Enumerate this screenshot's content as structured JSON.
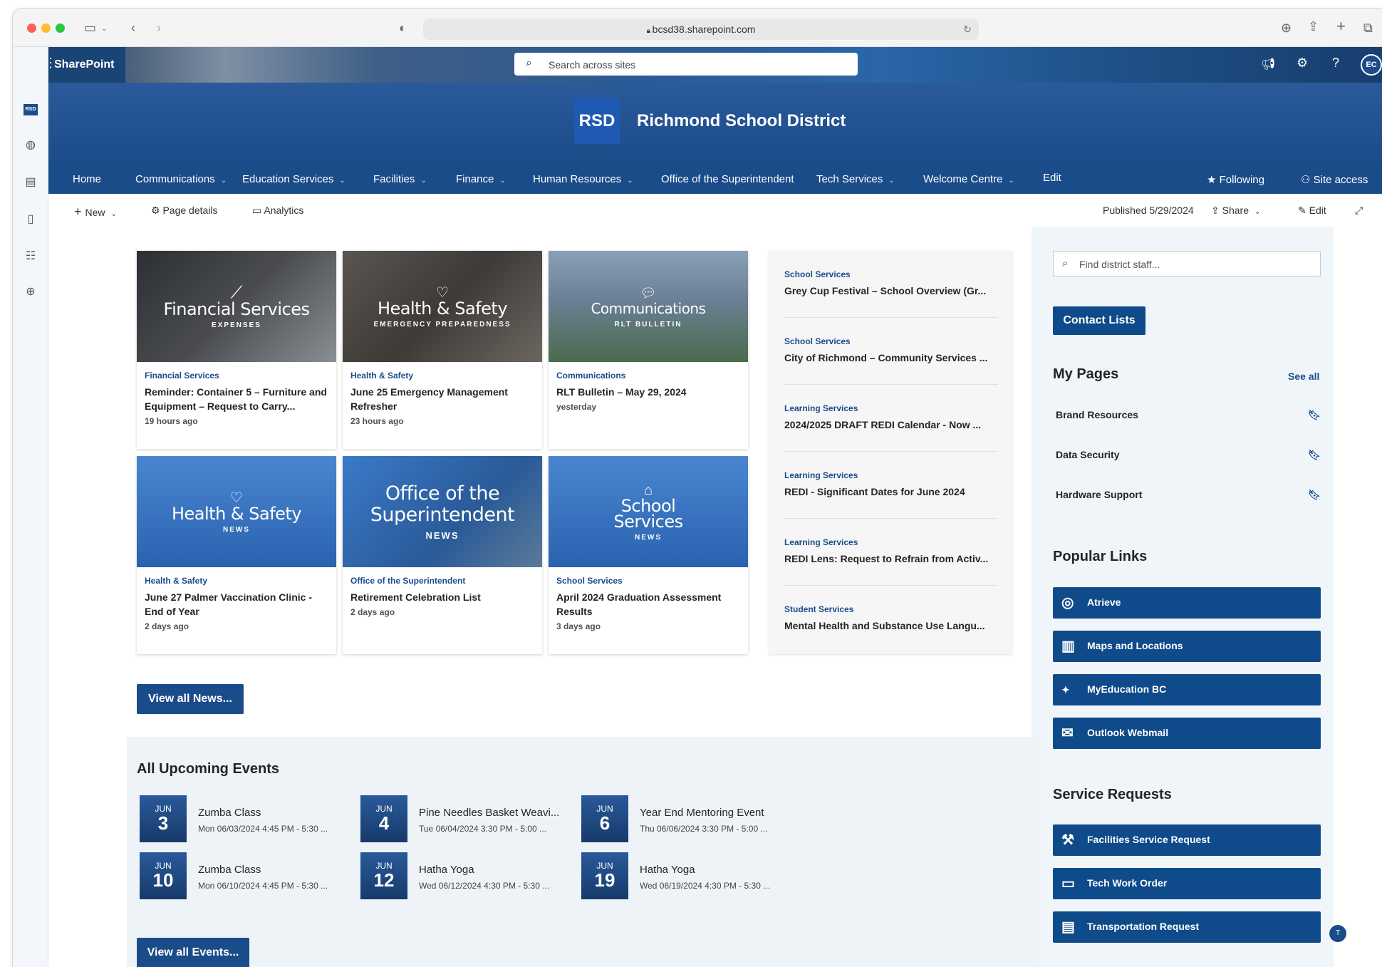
{
  "browser": {
    "url": "bcsd38.sharepoint.com"
  },
  "suite": {
    "app_name": "SharePoint",
    "search_placeholder": "Search across sites",
    "avatar": "EC"
  },
  "site": {
    "logo": "RSD",
    "title": "Richmond School District"
  },
  "nav": {
    "items": [
      "Home",
      "Communications",
      "Education Services",
      "Facilities",
      "Finance",
      "Human Resources",
      "Office of the Superintendent",
      "Tech Services",
      "Welcome Centre",
      "Edit"
    ],
    "following": "Following",
    "site_access": "Site access"
  },
  "commandbar": {
    "new": "New",
    "page_details": "Page details",
    "analytics": "Analytics",
    "published": "Published 5/29/2024",
    "share": "Share",
    "edit": "Edit"
  },
  "news_cards": [
    {
      "img_title": "Financial Services",
      "img_sub": "EXPENSES",
      "category": "Financial Services",
      "title": "Reminder: Container 5 – Furniture and Equipment – Request to Carry...",
      "time": "19 hours ago"
    },
    {
      "img_title": "Health & Safety",
      "img_sub": "EMERGENCY PREPAREDNESS",
      "category": "Health & Safety",
      "title": "June 25 Emergency Management Refresher",
      "time": "23 hours ago"
    },
    {
      "img_title": "Communications",
      "img_sub": "RLT BULLETIN",
      "category": "Communications",
      "title": "RLT Bulletin – May 29, 2024",
      "time": "yesterday"
    },
    {
      "img_title": "Health & Safety",
      "img_sub": "NEWS",
      "category": "Health & Safety",
      "title": "June 27 Palmer Vaccination Clinic - End of Year",
      "time": "2 days ago"
    },
    {
      "img_title": "Office of the Superintendent",
      "img_sub": "NEWS",
      "category": "Office of the Superintendent",
      "title": "Retirement Celebration List",
      "time": "2 days ago"
    },
    {
      "img_title": "School Services",
      "img_sub": "NEWS",
      "category": "School Services",
      "title": "April 2024 Graduation Assessment Results",
      "time": "3 days ago"
    }
  ],
  "news_list": [
    {
      "category": "School Services",
      "title": "Grey Cup Festival – School Overview (Gr..."
    },
    {
      "category": "School Services",
      "title": "City of Richmond – Community Services ..."
    },
    {
      "category": "Learning Services",
      "title": "2024/2025 DRAFT REDI Calendar - Now ..."
    },
    {
      "category": "Learning Services",
      "title": "REDI - Significant Dates for June 2024"
    },
    {
      "category": "Learning Services",
      "title": "REDI Lens: Request to Refrain from Activ..."
    },
    {
      "category": "Student Services",
      "title": "Mental Health and Substance Use Langu..."
    }
  ],
  "view_all_news": "View all News...",
  "events": {
    "heading": "All Upcoming Events",
    "items": [
      {
        "month": "JUN",
        "day": "3",
        "title": "Zumba Class",
        "time": "Mon 06/03/2024 4:45 PM - 5:30 ..."
      },
      {
        "month": "JUN",
        "day": "4",
        "title": "Pine Needles Basket Weavi...",
        "time": "Tue 06/04/2024 3:30 PM - 5:00 ..."
      },
      {
        "month": "JUN",
        "day": "6",
        "title": "Year End Mentoring Event",
        "time": "Thu 06/06/2024 3:30 PM - 5:00 ..."
      },
      {
        "month": "JUN",
        "day": "10",
        "title": "Zumba Class",
        "time": "Mon 06/10/2024 4:45 PM - 5:30 ..."
      },
      {
        "month": "JUN",
        "day": "12",
        "title": "Hatha Yoga",
        "time": "Wed 06/12/2024 4:30 PM - 5:30 ..."
      },
      {
        "month": "JUN",
        "day": "19",
        "title": "Hatha Yoga",
        "time": "Wed 06/19/2024 4:30 PM - 5:30 ..."
      }
    ],
    "view_all": "View all Events..."
  },
  "right": {
    "search_placeholder": "Find district staff...",
    "contact_lists": "Contact Lists",
    "my_pages": "My Pages",
    "see_all": "See all",
    "pages": [
      "Brand Resources",
      "Data Security",
      "Hardware Support"
    ],
    "popular_links": "Popular Links",
    "links": [
      "Atrieve",
      "Maps and Locations",
      "MyEducation BC",
      "Outlook Webmail"
    ],
    "service_requests": "Service Requests",
    "requests": [
      "Facilities Service Request",
      "Tech Work Order",
      "Transportation Request"
    ]
  },
  "colors": {
    "brand": "#1b4c8a",
    "button": "#0f4a8a"
  }
}
